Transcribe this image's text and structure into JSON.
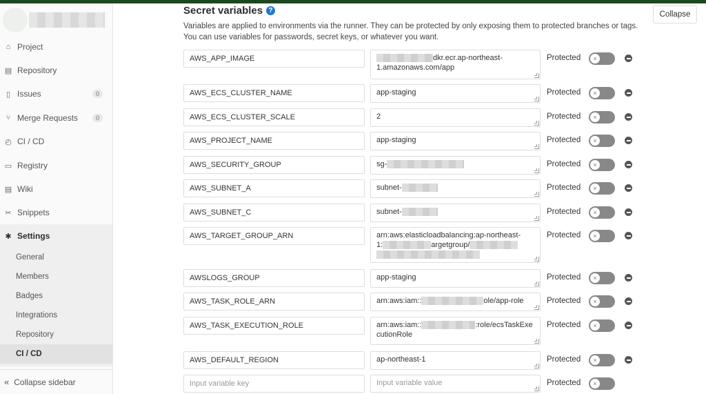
{
  "sidebar": {
    "items": [
      {
        "label": "Project",
        "icon": "home-icon",
        "badge": null
      },
      {
        "label": "Repository",
        "icon": "book-icon",
        "badge": null
      },
      {
        "label": "Issues",
        "icon": "issues-icon",
        "badge": "0"
      },
      {
        "label": "Merge Requests",
        "icon": "merge-request-icon",
        "badge": "0"
      },
      {
        "label": "CI / CD",
        "icon": "rocket-icon",
        "badge": null
      },
      {
        "label": "Registry",
        "icon": "container-icon",
        "badge": null
      },
      {
        "label": "Wiki",
        "icon": "book-icon",
        "badge": null
      },
      {
        "label": "Snippets",
        "icon": "scissors-icon",
        "badge": null
      },
      {
        "label": "Settings",
        "icon": "gear-icon",
        "badge": null
      }
    ],
    "settings_sub": [
      "General",
      "Members",
      "Badges",
      "Integrations",
      "Repository",
      "CI / CD"
    ],
    "collapse_label": "Collapse sidebar"
  },
  "section": {
    "title": "Secret variables",
    "description": "Variables are applied to environments via the runner. They can be protected by only exposing them to protected branches or tags. You can use variables for passwords, secret keys, or whatever you want.",
    "collapse_label": "Collapse"
  },
  "variables": {
    "protected_label": "Protected",
    "rows": [
      {
        "key": "AWS_APP_IMAGE",
        "value_visible": "dkr.ecr.ap-northeast-1.amazonaws.com/app"
      },
      {
        "key": "AWS_ECS_CLUSTER_NAME",
        "value_visible": "app-staging"
      },
      {
        "key": "AWS_ECS_CLUSTER_SCALE",
        "value_visible": "2"
      },
      {
        "key": "AWS_PROJECT_NAME",
        "value_visible": "app-staging"
      },
      {
        "key": "AWS_SECURITY_GROUP",
        "value_visible": "sg-"
      },
      {
        "key": "AWS_SUBNET_A",
        "value_visible": "subnet-"
      },
      {
        "key": "AWS_SUBNET_C",
        "value_visible": "subnet-"
      },
      {
        "key": "AWS_TARGET_GROUP_ARN",
        "value_visible": "arn:aws:elasticloadbalancing:ap-northeast-1:"
      },
      {
        "key": "AWSLOGS_GROUP",
        "value_visible": "app-staging"
      },
      {
        "key": "AWS_TASK_ROLE_ARN",
        "value_visible": "arn:aws:iam::"
      },
      {
        "key": "AWS_TASK_EXECUTION_ROLE",
        "value_visible": "arn:aws:iam::"
      },
      {
        "key": "AWS_DEFAULT_REGION",
        "value_visible": "ap-northeast-1"
      }
    ],
    "new_key_placeholder": "Input variable key",
    "new_value_placeholder": "Input variable value"
  },
  "fragments": {
    "row0_tail": "dkr.ecr.ap-northeast-",
    "row0_line2": "1.amazonaws.com/app",
    "row7_line1": "arn:aws:elasticloadbalancing:ap-northeast-",
    "row7_line2a": "1:",
    "row7_line2b": "argetgroup/",
    "row9_tail": "ole/app-role",
    "row10_tail": ":role/ecsTaskExe",
    "row10_line2": "cutionRole"
  },
  "colors": {
    "accent": "#1f78d1",
    "topbar": "#1e4620",
    "toggle_off": "#888888"
  }
}
